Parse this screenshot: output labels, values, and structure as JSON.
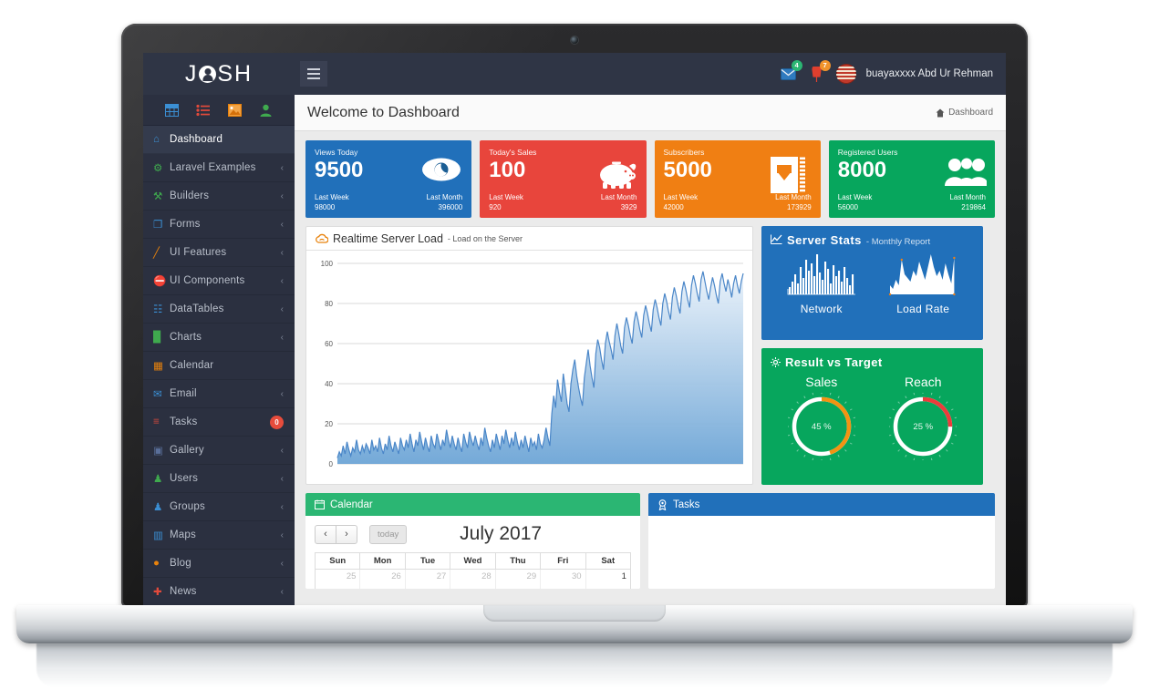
{
  "brand": {
    "name_left": "J",
    "name_right": "SH",
    "logo_icon": "user-circle-icon"
  },
  "topbar": {
    "hamburger_icon": "hamburger-icon",
    "mail_icon": "envelope-icon",
    "mail_badge": "4",
    "pin_icon": "pin-icon",
    "pin_badge": "7",
    "avatar_icon": "avatar-icon",
    "username": "buayaxxxx Abd Ur Rehman"
  },
  "quick_icons": [
    {
      "name": "table-icon",
      "color": "#3b8fd4"
    },
    {
      "name": "list-icon",
      "color": "#e24a3b"
    },
    {
      "name": "image-icon",
      "color": "#e8820c"
    },
    {
      "name": "user-icon",
      "color": "#3faa4e"
    }
  ],
  "sidebar": {
    "items": [
      {
        "label": "Dashboard",
        "icon": "home-icon",
        "color": "#3b8fd4",
        "glyph": "⌂",
        "caret": false,
        "active": true
      },
      {
        "label": "Laravel Examples",
        "icon": "award-icon",
        "color": "#3faa4e",
        "glyph": "⚙",
        "caret": true
      },
      {
        "label": "Builders",
        "icon": "wrench-icon",
        "color": "#3faa4e",
        "glyph": "⚒",
        "caret": true
      },
      {
        "label": "Forms",
        "icon": "file-icon",
        "color": "#3b8fd4",
        "glyph": "❐",
        "caret": true
      },
      {
        "label": "UI Features",
        "icon": "pencil-icon",
        "color": "#e8820c",
        "glyph": "╱",
        "caret": true
      },
      {
        "label": "UI Components",
        "icon": "cone-icon",
        "color": "#e24a3b",
        "glyph": "⛔",
        "caret": true
      },
      {
        "label": "DataTables",
        "icon": "table-icon",
        "color": "#3b8fd4",
        "glyph": "☷",
        "caret": true
      },
      {
        "label": "Charts",
        "icon": "bar-chart-icon",
        "color": "#3faa4e",
        "glyph": "█",
        "caret": true
      },
      {
        "label": "Calendar",
        "icon": "calendar-icon",
        "color": "#e8820c",
        "glyph": "▦",
        "caret": false
      },
      {
        "label": "Email",
        "icon": "envelope-icon",
        "color": "#3b8fd4",
        "glyph": "✉",
        "caret": true
      },
      {
        "label": "Tasks",
        "icon": "tasks-icon",
        "color": "#e24a3b",
        "glyph": "≡",
        "caret": false,
        "badge": "0"
      },
      {
        "label": "Gallery",
        "icon": "image-icon",
        "color": "#5a6f9a",
        "glyph": "▣",
        "caret": true
      },
      {
        "label": "Users",
        "icon": "user-icon",
        "color": "#3faa4e",
        "glyph": "♟",
        "caret": true
      },
      {
        "label": "Groups",
        "icon": "group-icon",
        "color": "#3b8fd4",
        "glyph": "♟",
        "caret": true
      },
      {
        "label": "Maps",
        "icon": "map-icon",
        "color": "#3b8fd4",
        "glyph": "▥",
        "caret": true
      },
      {
        "label": "Blog",
        "icon": "comment-icon",
        "color": "#e8820c",
        "glyph": "●",
        "caret": true
      },
      {
        "label": "News",
        "icon": "news-icon",
        "color": "#e24a3b",
        "glyph": "✚",
        "caret": true
      }
    ]
  },
  "page": {
    "title": "Welcome to Dashboard",
    "breadcrumb_icon": "home-icon",
    "breadcrumb_label": "Dashboard"
  },
  "stats": [
    {
      "title": "Views Today",
      "value": "9500",
      "last_week_label": "Last Week",
      "last_week": "98000",
      "last_month_label": "Last Month",
      "last_month": "396000",
      "color": "#2170ba",
      "icon": "eye-icon"
    },
    {
      "title": "Today's Sales",
      "value": "100",
      "last_week_label": "Last Week",
      "last_week": "920",
      "last_month_label": "Last Month",
      "last_month": "3929",
      "color": "#e8453c",
      "icon": "piggy-bank-icon"
    },
    {
      "title": "Subscribers",
      "value": "5000",
      "last_week_label": "Last Week",
      "last_week": "42000",
      "last_month_label": "Last Month",
      "last_month": "173929",
      "color": "#f07f13",
      "icon": "download-icon"
    },
    {
      "title": "Registered Users",
      "value": "8000",
      "last_week_label": "Last Week",
      "last_week": "56000",
      "last_month_label": "Last Month",
      "last_month": "219864",
      "color": "#07a65d",
      "icon": "users-icon"
    }
  ],
  "realtime": {
    "icon": "cloud-icon",
    "title": "Realtime Server Load",
    "subtitle": "- Load on the Server"
  },
  "chart_data": {
    "type": "area",
    "title": "Realtime Server Load",
    "subtitle": "Load on the Server",
    "xlabel": "",
    "ylabel": "",
    "ylim": [
      0,
      100
    ],
    "yticks": [
      0,
      20,
      40,
      60,
      80,
      100
    ],
    "grid": true,
    "legend": "none",
    "line_color": "#4a86c8",
    "fill_top": "#eaf2fa",
    "fill_bottom": "#6da5d6",
    "series": [
      {
        "name": "Server Load",
        "values": [
          3,
          6,
          4,
          9,
          5,
          11,
          7,
          4,
          8,
          6,
          12,
          7,
          5,
          9,
          6,
          10,
          8,
          5,
          12,
          7,
          9,
          6,
          13,
          8,
          5,
          10,
          7,
          14,
          9,
          6,
          11,
          8,
          5,
          13,
          9,
          7,
          12,
          8,
          15,
          10,
          6,
          12,
          9,
          16,
          11,
          7,
          13,
          9,
          6,
          14,
          10,
          8,
          15,
          11,
          7,
          12,
          9,
          17,
          12,
          8,
          14,
          10,
          7,
          13,
          9,
          6,
          15,
          11,
          8,
          16,
          12,
          9,
          14,
          10,
          7,
          13,
          9,
          18,
          13,
          9,
          6,
          12,
          8,
          15,
          11,
          7,
          14,
          10,
          17,
          12,
          8,
          13,
          9,
          16,
          11,
          7,
          12,
          8,
          14,
          10,
          6,
          13,
          9,
          11,
          7,
          15,
          10,
          8,
          12,
          18,
          13,
          9,
          25,
          34,
          28,
          42,
          36,
          31,
          45,
          38,
          30,
          26,
          40,
          47,
          52,
          44,
          38,
          33,
          29,
          43,
          50,
          57,
          49,
          43,
          38,
          55,
          62,
          58,
          52,
          47,
          60,
          66,
          61,
          57,
          52,
          64,
          70,
          65,
          59,
          55,
          68,
          73,
          69,
          64,
          60,
          71,
          76,
          72,
          67,
          63,
          74,
          79,
          75,
          70,
          66,
          77,
          82,
          78,
          73,
          69,
          80,
          85,
          81,
          76,
          72,
          83,
          88,
          84,
          79,
          75,
          86,
          91,
          87,
          82,
          78,
          89,
          94,
          90,
          85,
          81,
          92,
          96,
          91,
          86,
          82,
          88,
          93,
          89,
          84,
          80,
          91,
          95,
          90,
          86,
          92,
          88,
          83,
          90,
          94,
          89,
          85,
          91,
          95
        ]
      }
    ]
  },
  "server_stats": {
    "icon": "line-chart-icon",
    "title": "Server Stats",
    "subtitle": "- Monthly Report",
    "cells": [
      {
        "label": "Network",
        "type": "bar"
      },
      {
        "label": "Load Rate",
        "type": "area"
      }
    ],
    "bg_color": "#2170ba"
  },
  "result_target": {
    "icon": "spinner-icon",
    "title": "Result vs Target",
    "bg_color": "#07a65d",
    "gauges": [
      {
        "label": "Sales",
        "value": 45,
        "value_text": "45 %",
        "color": "#f29312"
      },
      {
        "label": "Reach",
        "value": 25,
        "value_text": "25 %",
        "color": "#ed3b3b"
      }
    ]
  },
  "calendar": {
    "icon": "calendar-icon",
    "title": "Calendar",
    "prev_label": "‹",
    "next_label": "›",
    "today_label": "today",
    "month_label": "July 2017",
    "dow": [
      "Sun",
      "Mon",
      "Tue",
      "Wed",
      "Thu",
      "Fri",
      "Sat"
    ],
    "first_week": [
      {
        "day": "25",
        "current": false
      },
      {
        "day": "26",
        "current": false
      },
      {
        "day": "27",
        "current": false
      },
      {
        "day": "28",
        "current": false
      },
      {
        "day": "29",
        "current": false
      },
      {
        "day": "30",
        "current": false
      },
      {
        "day": "1",
        "current": true
      }
    ],
    "header_color": "#2bb673"
  },
  "tasks": {
    "icon": "award-icon",
    "title": "Tasks",
    "header_color": "#2170ba"
  }
}
